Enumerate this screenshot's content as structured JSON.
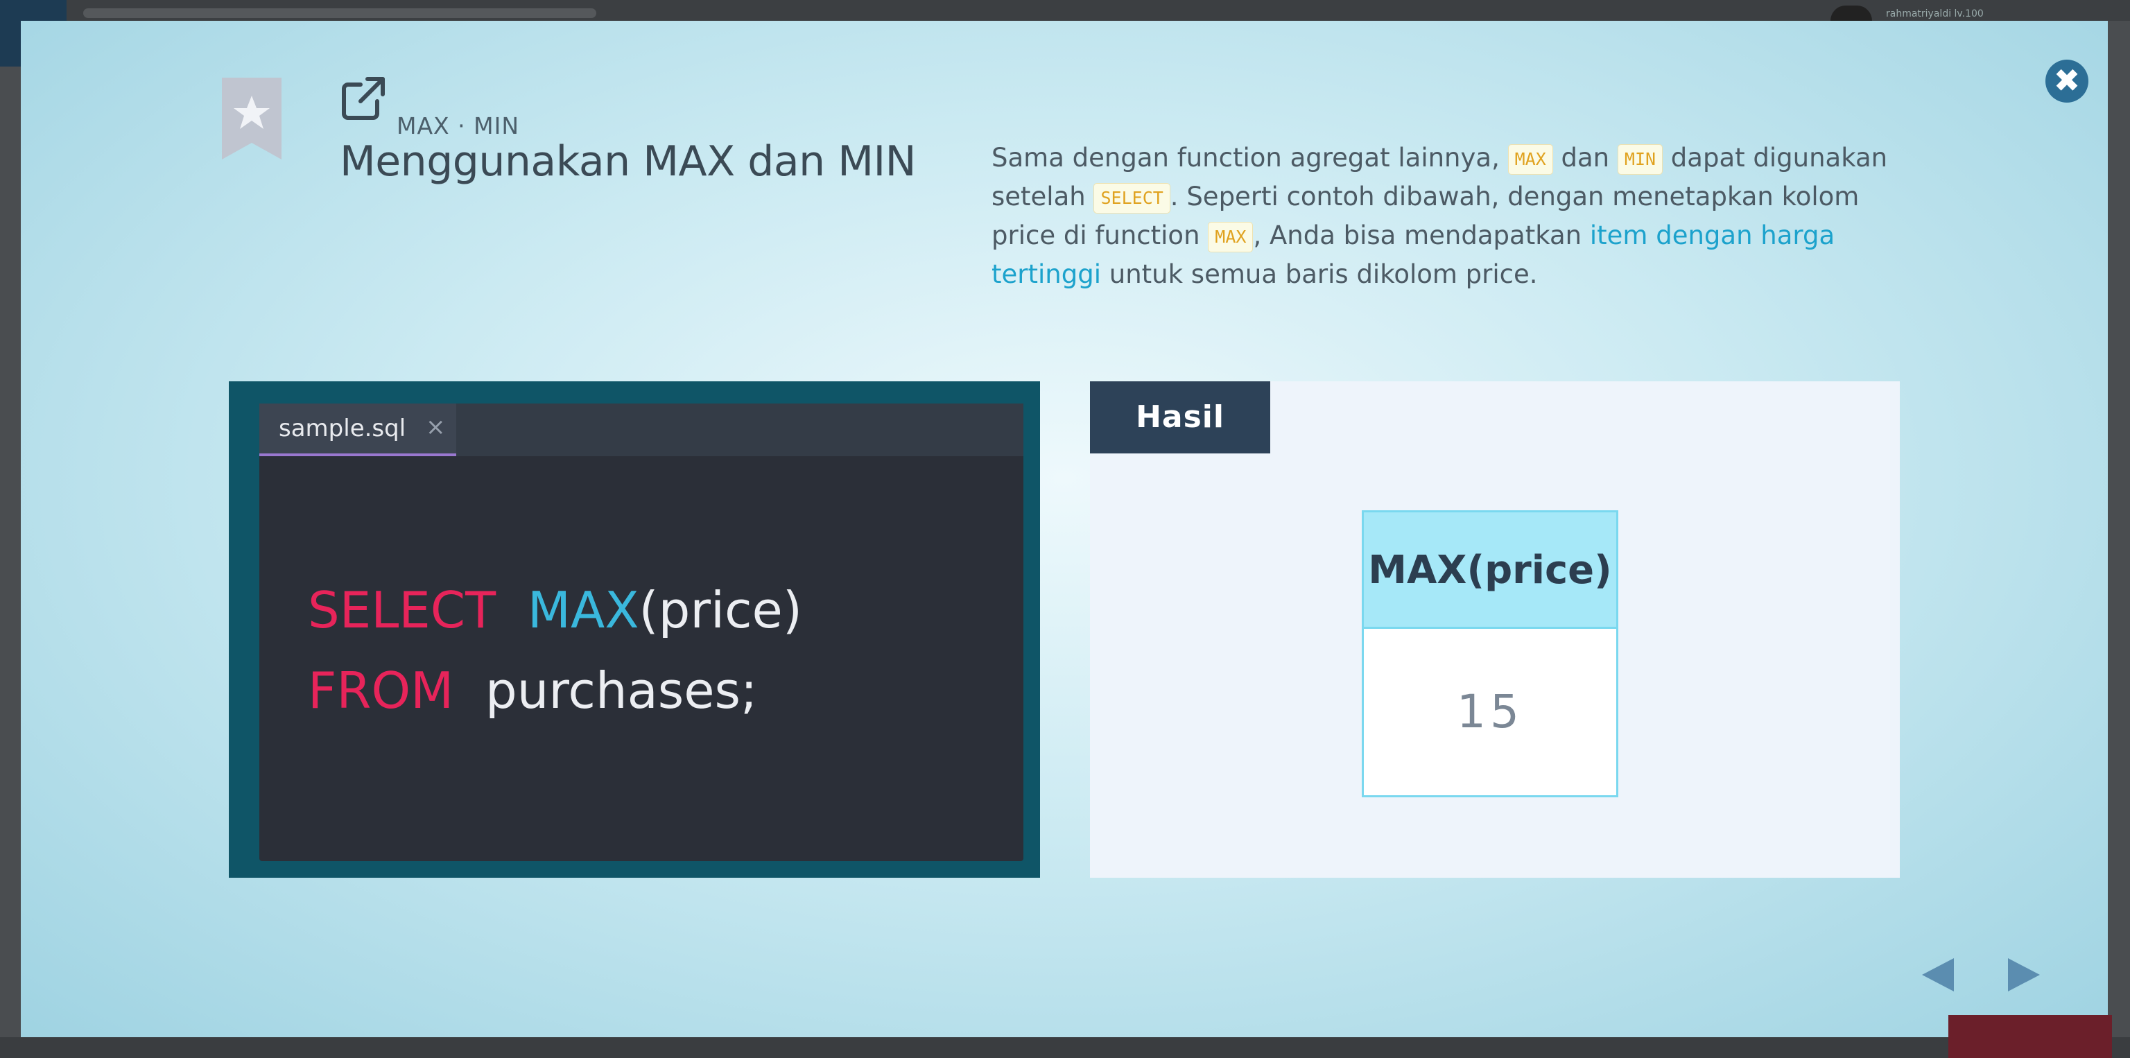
{
  "background": {
    "username": "rahmatriyaldi lv.100"
  },
  "modal": {
    "breadcrumb": "MAX · MIN",
    "title": "Menggunakan MAX dan MIN",
    "description": {
      "p1": "Sama dengan function agregat lainnya, ",
      "code1": "MAX",
      "p2": " dan ",
      "code2": "MIN",
      "p3": " dapat digunakan setelah ",
      "code3": "SELECT",
      "p4": ". Seperti contoh dibawah, dengan menetapkan kolom price di function ",
      "code4": "MAX",
      "p5": ", Anda bisa mendapatkan ",
      "highlight": "item dengan harga tertinggi",
      "p6": " untuk semua baris dikolom price."
    },
    "editor": {
      "tab_name": "sample.sql",
      "tab_close": "×",
      "line1_kw": "SELECT",
      "line1_fn": "MAX",
      "line1_rest": "(price)",
      "line2_kw": "FROM",
      "line2_rest": "purchases;"
    },
    "result": {
      "label": "Hasil",
      "column_header": "MAX(price)",
      "value": "15"
    }
  },
  "colors": {
    "accent": "#2c6e96",
    "keyword": "#e7245a",
    "function": "#3ab8dd",
    "highlight": "#1ca2cc",
    "hasil_bg": "#2d4258",
    "nav_arrow": "#5b8db0"
  },
  "icons": {
    "close": "close-icon",
    "bookmark": "bookmark-star-icon",
    "external": "external-link-icon",
    "prev": "arrow-left-icon",
    "next": "arrow-right-icon"
  }
}
